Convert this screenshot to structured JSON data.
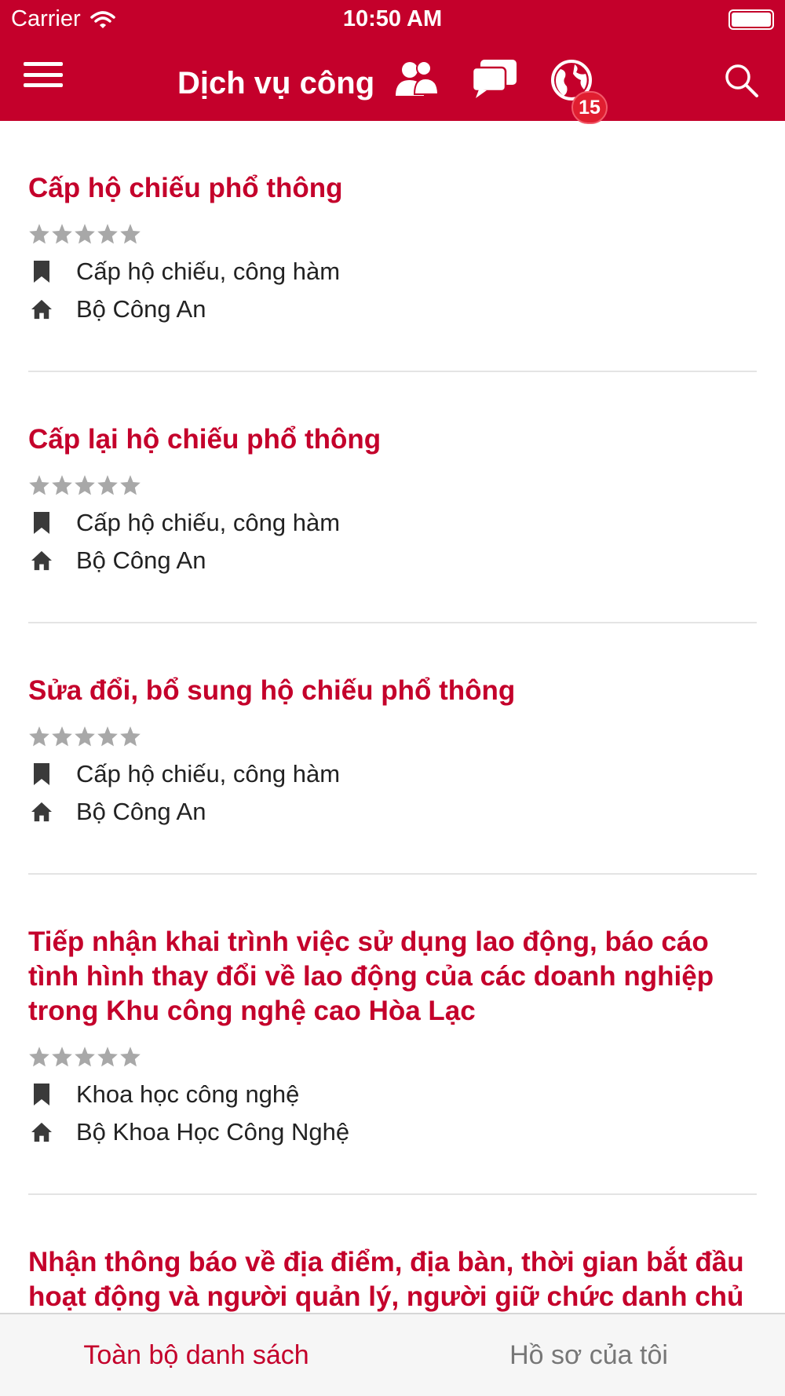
{
  "status_bar": {
    "carrier": "Carrier",
    "time": "10:50 AM"
  },
  "nav": {
    "title": "Dịch vụ công",
    "badge_count": "15",
    "icons": [
      "menu-icon",
      "contacts-icon",
      "chat-icon",
      "globe-icon",
      "search-icon"
    ]
  },
  "colors": {
    "brand": "#c4002b",
    "badge": "#e01e30",
    "star": "#a8a8a8",
    "divider": "#e4e4e4"
  },
  "services": [
    {
      "title": "Cấp hộ chiếu phổ thông",
      "rating": 0,
      "category": "Cấp hộ chiếu, công hàm",
      "agency": "Bộ Công An"
    },
    {
      "title": "Cấp lại hộ chiếu phổ thông",
      "rating": 0,
      "category": "Cấp hộ chiếu, công hàm",
      "agency": "Bộ Công An"
    },
    {
      "title": "Sửa đổi, bổ sung hộ chiếu phổ thông",
      "rating": 0,
      "category": "Cấp hộ chiếu, công hàm",
      "agency": "Bộ Công An"
    },
    {
      "title": "Tiếp nhận khai trình việc sử dụng lao động, báo cáo tình hình thay đổi về lao động của các doanh nghiệp trong Khu công nghệ cao Hòa Lạc",
      "rating": 0,
      "category": "Khoa học công nghệ",
      "agency": "Bộ Khoa Học Công Nghệ"
    },
    {
      "title": "Nhận thông báo về địa điểm, địa bàn, thời gian bắt đầu hoạt động và người quản lý, người giữ chức danh chủ chốt của doanh nghiệp cho thuê lại lao"
    }
  ],
  "tabs": {
    "all": "Toàn bộ danh sách",
    "mine": "Hồ sơ của tôi"
  }
}
